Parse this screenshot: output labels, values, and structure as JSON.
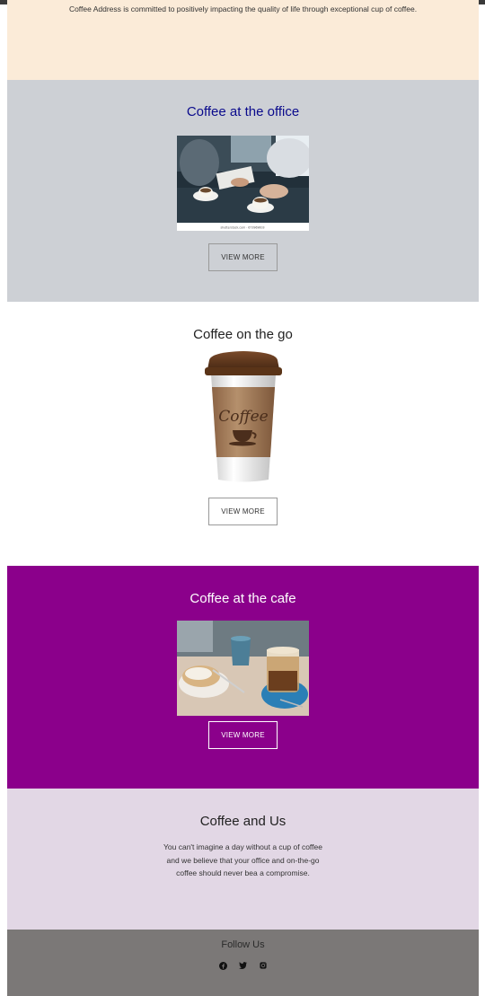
{
  "intro": {
    "text": "Coffee Address is committed to positively impacting the quality of life through exceptional cup of coffee."
  },
  "office": {
    "title": "Coffee at the office",
    "button": "VIEW MORE",
    "image_caption": "shutterstock.com · 673969603"
  },
  "go": {
    "title": "Coffee on the go",
    "button": "VIEW MORE",
    "cup_label": "Coffee"
  },
  "cafe": {
    "title": "Coffee at the cafe",
    "button": "VIEW MORE"
  },
  "about": {
    "title": "Coffee and Us",
    "text": "You can't imagine a day without a cup of coffee and we believe that your office and on-the-go coffee should never bea a compromise."
  },
  "footer": {
    "title": "Follow Us",
    "icons": [
      "facebook-icon",
      "twitter-icon",
      "instagram-icon"
    ]
  },
  "colors": {
    "intro_bg": "#fbebd8",
    "office_bg": "#cdd0d5",
    "office_title": "#0a0a8c",
    "cafe_bg": "#8b008b",
    "about_bg": "#e2d7e5",
    "footer_bg": "#7b7877"
  }
}
